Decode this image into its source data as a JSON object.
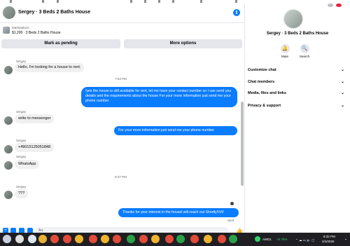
{
  "header": {
    "title": "Sergey · 3 Beds 2 Baths House",
    "info_glyph": "i",
    "avatar_icon": "avatar-icon"
  },
  "marketplace": {
    "label": "Marketplace",
    "listing": "$1,200 · 3 Beds 2 Baths House",
    "mark_pending": "Mark as pending",
    "more_options": "More options"
  },
  "conversation": {
    "messages": [
      {
        "sender": "Sergey",
        "text": "Hello, I'm looking for a house to rent."
      },
      {
        "time": "7:53 PM"
      },
      {
        "outgoing": "/yes the house is still available for rent, let me have your contact number so I can send you details and the requirements about the house For  your  more  information  just  send  me   your  phone  number"
      },
      {
        "sender": "Sergey",
        "text": "write to messenger"
      },
      {
        "outgoing": "For  your  more  information  just  send  me   your  phone  number"
      },
      {
        "sender": "Sergey",
        "text": "+49015125051848"
      },
      {
        "sender": "Sergey",
        "text": "WhatsApp"
      },
      {
        "time": "8:27 PM"
      },
      {
        "sender": "Sergey",
        "text": "???"
      },
      {
        "outgoing": "Thanks for your interest in the housel will reach out Shortly!!/////"
      }
    ],
    "sent_label": "Sent"
  },
  "composer": {
    "placeholder": "Aa",
    "like_glyph": "👍",
    "icons": [
      "add-icon",
      "image-icon",
      "sticker-icon",
      "gif-icon"
    ]
  },
  "details_panel": {
    "name": "Sergey · 3 Beds 2 Baths House",
    "actions": [
      {
        "label": "Mute",
        "icon": "bell-icon",
        "glyph": "🔔"
      },
      {
        "label": "Search",
        "icon": "search-icon",
        "glyph": "🔍"
      }
    ],
    "sections": [
      "Customize chat",
      "Chat members",
      "Media, files and links",
      "Privacy & support"
    ]
  },
  "taskbar": {
    "stock_name": "AWD1",
    "stock_change": "+0.75%",
    "time": "8:32 PM",
    "date": "2/4/2025"
  },
  "colors": {
    "accent": "#0a7cff",
    "incoming_bubble": "#f0f0f0",
    "taskbar": "#1f1f23",
    "stock_up": "#2fd46b"
  }
}
